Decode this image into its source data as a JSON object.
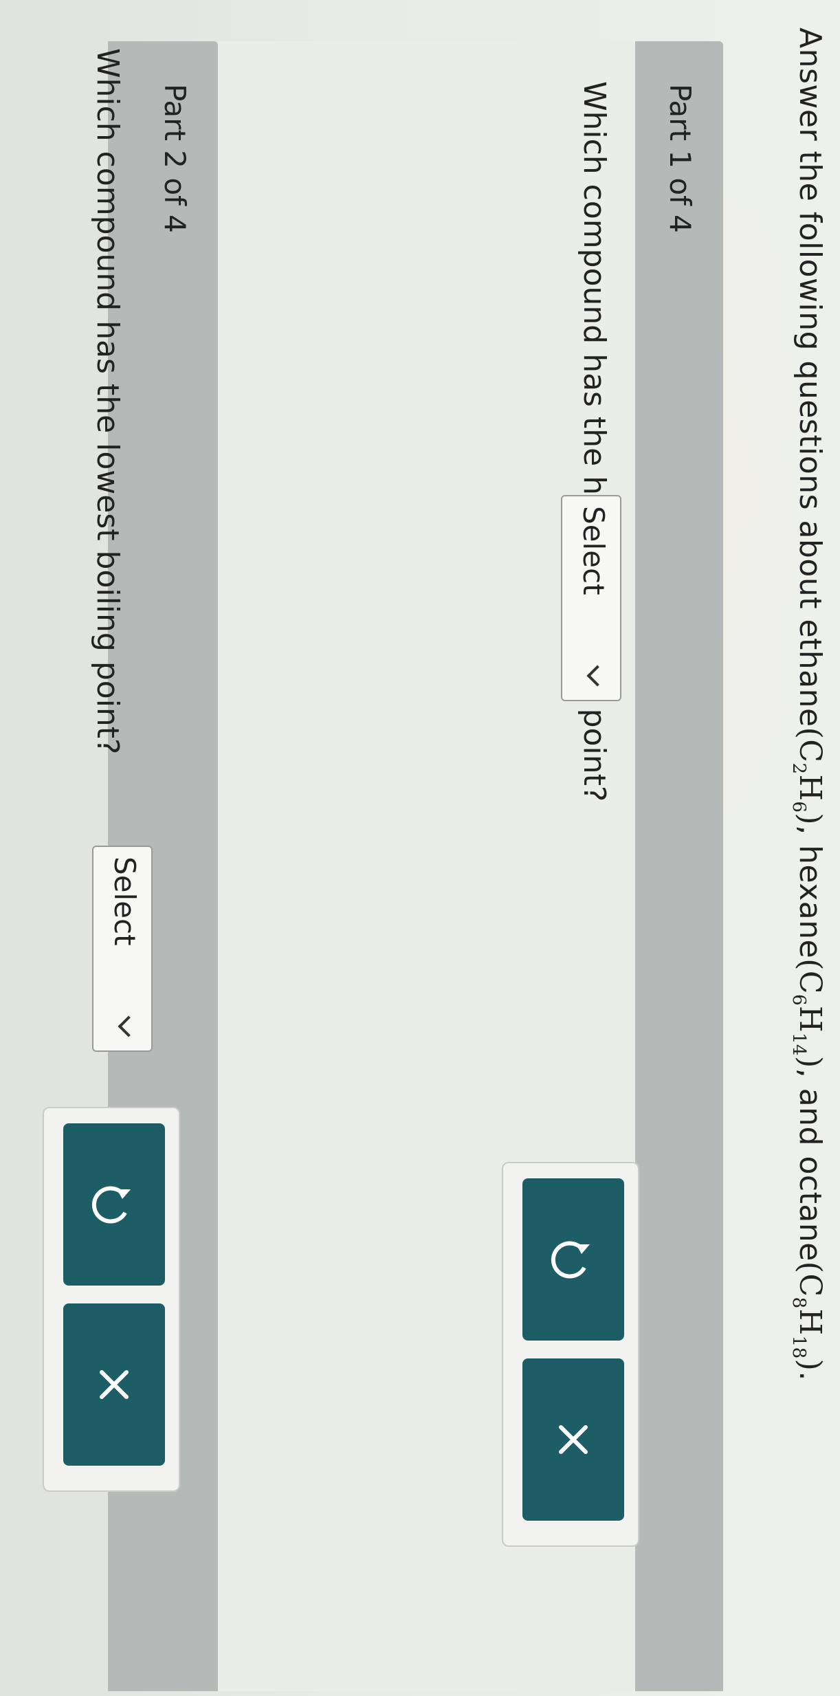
{
  "intro": {
    "text": "Answer the following questions about ethane",
    "ethane": {
      "c": "C",
      "c_sub": "2",
      "h": "H",
      "h_sub": "6"
    },
    "sep1": ", hexane",
    "hexane": {
      "c": "C",
      "c_sub": "6",
      "h": "H",
      "h_sub": "14"
    },
    "sep2": ", and octane",
    "octane": {
      "c": "C",
      "c_sub": "8",
      "h": "H",
      "h_sub": "18"
    },
    "end": "."
  },
  "parts": [
    {
      "label": "Part 1 of 4",
      "question": "Which compound has the highest boiling point?",
      "select_value": "Select"
    },
    {
      "label": "Part 2 of 4",
      "question": "Which compound has the lowest boiling point?",
      "select_value": "Select"
    }
  ],
  "buttons": {
    "reset_icon": "reset-icon",
    "clear_icon": "close-icon",
    "color": "#1d5d66"
  }
}
